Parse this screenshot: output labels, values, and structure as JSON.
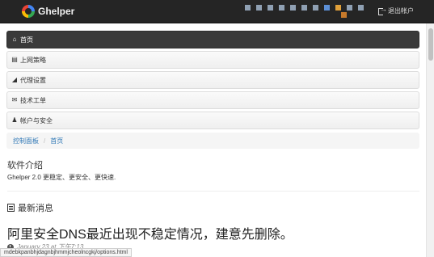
{
  "brand": {
    "name": "Ghelper"
  },
  "topbar": {
    "logout_label": "退出帐户"
  },
  "nav": {
    "items": [
      {
        "label": "首页",
        "icon": "home-icon",
        "active": true
      },
      {
        "label": "上网策略",
        "icon": "list-icon",
        "active": false
      },
      {
        "label": "代理设置",
        "icon": "signal-icon",
        "active": false
      },
      {
        "label": "技术工单",
        "icon": "envelope-icon",
        "active": false
      },
      {
        "label": "帐户与安全",
        "icon": "user-icon",
        "active": false
      }
    ]
  },
  "breadcrumb": {
    "items": [
      "控制面板",
      "首页"
    ],
    "separator": "/"
  },
  "about": {
    "title": "软件介绍",
    "text": "Ghelper 2.0 更稳定、更安全、更快速."
  },
  "news": {
    "title": "最新消息",
    "headline": "阿里安全DNS最近出现不稳定情况，建意先删除。",
    "date": "January 23 at 下午7:13"
  },
  "statusbar": {
    "url": "mdebkpanbhjdagnbjhmmjcheolncgkj/options.html"
  },
  "colors": {
    "topbar_bg": "#252525",
    "active_nav_bg": "#3a3a3a",
    "link": "#337ab7"
  }
}
